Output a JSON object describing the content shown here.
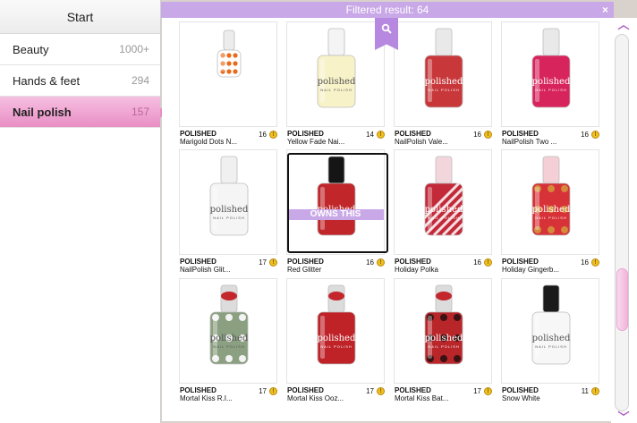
{
  "sidebar": {
    "title": "Start",
    "items": [
      {
        "label": "Beauty",
        "count": "1000+"
      },
      {
        "label": "Hands & feet",
        "count": "294"
      },
      {
        "label": "Nail polish",
        "count": "157"
      }
    ]
  },
  "topbar": {
    "filter_text": "Filtered result: 64",
    "close_glyph": "×"
  },
  "scroll": {
    "up_glyph": "︿",
    "down_glyph": "﹀",
    "position_fraction": 0.75
  },
  "products": [
    {
      "brand": "POLISHED",
      "name": "Marigold Dots N...",
      "price": "16",
      "bottle": "dots-orange"
    },
    {
      "brand": "POLISHED",
      "name": "Yellow Fade Nai...",
      "price": "14",
      "bottle": "yellow"
    },
    {
      "brand": "POLISHED",
      "name": "NailPolish Vale...",
      "price": "16",
      "bottle": "red-shimmer"
    },
    {
      "brand": "POLISHED",
      "name": "NailPolish Two ...",
      "price": "16",
      "bottle": "pink-fade"
    },
    {
      "brand": "POLISHED",
      "name": "NailPolish Glit...",
      "price": "17",
      "bottle": "white-glitter"
    },
    {
      "brand": "POLISHED",
      "name": "Red Glitter",
      "price": "16",
      "bottle": "red-glitter",
      "owned_label": "OWNS THIS"
    },
    {
      "brand": "POLISHED",
      "name": "Holiday Polka",
      "price": "16",
      "bottle": "candy-stripe"
    },
    {
      "brand": "POLISHED",
      "name": "Holiday Gingerb...",
      "price": "16",
      "bottle": "gingerbread"
    },
    {
      "brand": "POLISHED",
      "name": "Mortal Kiss R.I...",
      "price": "17",
      "bottle": "skulls-green"
    },
    {
      "brand": "POLISHED",
      "name": "Mortal Kiss Ooz...",
      "price": "17",
      "bottle": "red-kiss"
    },
    {
      "brand": "POLISHED",
      "name": "Mortal Kiss Bat...",
      "price": "17",
      "bottle": "bats-red"
    },
    {
      "brand": "POLISHED",
      "name": "Snow White",
      "price": "11",
      "bottle": "snow-white"
    }
  ],
  "bottle_label": {
    "word": "polished",
    "sub": "NAIL POLISH"
  },
  "colors": {
    "accent_purple": "#c9a8e8",
    "active_pink": "#e98ec5",
    "coin_gold": "#f0c020"
  },
  "icons": [
    "search-icon",
    "close-icon",
    "coin-icon",
    "scroll-up-icon",
    "scroll-down-icon"
  ]
}
